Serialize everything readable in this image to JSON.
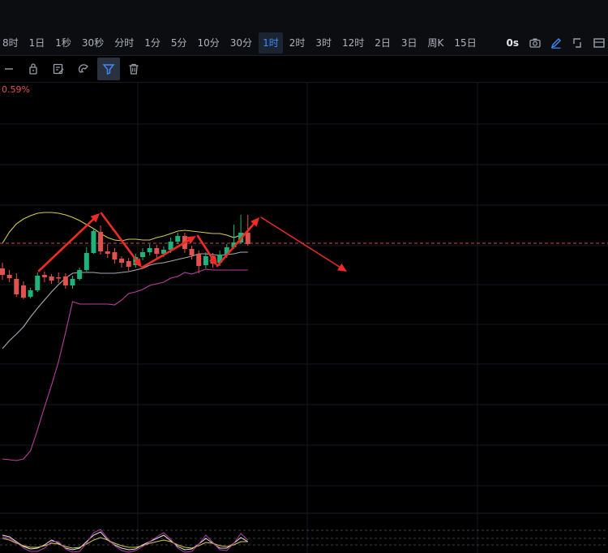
{
  "intervals": [
    {
      "label": "8时",
      "active": false
    },
    {
      "label": "1日",
      "active": false
    },
    {
      "label": "1秒",
      "active": false
    },
    {
      "label": "30秒",
      "active": false
    },
    {
      "label": "分时",
      "active": false
    },
    {
      "label": "1分",
      "active": false
    },
    {
      "label": "5分",
      "active": false
    },
    {
      "label": "10分",
      "active": false
    },
    {
      "label": "30分",
      "active": false
    },
    {
      "label": "1时",
      "active": true
    },
    {
      "label": "2时",
      "active": false
    },
    {
      "label": "3时",
      "active": false
    },
    {
      "label": "12时",
      "active": false
    },
    {
      "label": "2日",
      "active": false
    },
    {
      "label": "3日",
      "active": false
    },
    {
      "label": "周K",
      "active": false
    },
    {
      "label": "15日",
      "active": false
    }
  ],
  "right_tools": {
    "countdown_label": "0s",
    "icons": [
      "camera-icon",
      "pen-icon",
      "fullscreen-icon",
      "layout-icon"
    ]
  },
  "toolbar": {
    "icons": [
      "unknown-icon",
      "lock-icon",
      "edit-icon",
      "magnet-icon",
      "filter-icon",
      "trash-icon"
    ],
    "active_icon": "filter-icon"
  },
  "price_change": "0.59%",
  "colors": {
    "up": "#1db37a",
    "down": "#e0524f",
    "accent": "#3d8bff",
    "boll_upper": "#d6c94d",
    "boll_mid": "#a9aab0",
    "boll_lower": "#b6409f",
    "arrow": "#ef2b24",
    "price_line": "#c94a50"
  },
  "chart_data": {
    "type": "candlestick",
    "candles": [
      {
        "o": 331,
        "c": 339,
        "h": 324,
        "l": 345
      },
      {
        "o": 339,
        "c": 343,
        "h": 333,
        "l": 348
      },
      {
        "o": 344,
        "c": 363,
        "h": 337,
        "l": 366
      },
      {
        "o": 352,
        "c": 367,
        "h": 347,
        "l": 369
      },
      {
        "o": 366,
        "c": 358,
        "h": 355,
        "l": 368
      },
      {
        "o": 358,
        "c": 340,
        "h": 336,
        "l": 360
      },
      {
        "o": 339,
        "c": 342,
        "h": 335,
        "l": 348
      },
      {
        "o": 341,
        "c": 346,
        "h": 338,
        "l": 350
      },
      {
        "o": 342,
        "c": 343,
        "h": 336,
        "l": 349
      },
      {
        "o": 341,
        "c": 352,
        "h": 337,
        "l": 356
      },
      {
        "o": 352,
        "c": 344,
        "h": 340,
        "l": 356
      },
      {
        "o": 344,
        "c": 333,
        "h": 330,
        "l": 346
      },
      {
        "o": 333,
        "c": 312,
        "h": 305,
        "l": 335
      },
      {
        "o": 312,
        "c": 285,
        "h": 281,
        "l": 313
      },
      {
        "o": 286,
        "c": 310,
        "h": 278,
        "l": 314
      },
      {
        "o": 310,
        "c": 313,
        "h": 301,
        "l": 318
      },
      {
        "o": 311,
        "c": 320,
        "h": 306,
        "l": 325
      },
      {
        "o": 319,
        "c": 324,
        "h": 316,
        "l": 330
      },
      {
        "o": 322,
        "c": 329,
        "h": 318,
        "l": 334
      },
      {
        "o": 327,
        "c": 317,
        "h": 313,
        "l": 330
      },
      {
        "o": 317,
        "c": 311,
        "h": 306,
        "l": 321
      },
      {
        "o": 311,
        "c": 306,
        "h": 301,
        "l": 315
      },
      {
        "o": 306,
        "c": 313,
        "h": 302,
        "l": 318
      },
      {
        "o": 313,
        "c": 308,
        "h": 304,
        "l": 317
      },
      {
        "o": 308,
        "c": 298,
        "h": 293,
        "l": 312
      },
      {
        "o": 298,
        "c": 291,
        "h": 287,
        "l": 301
      },
      {
        "o": 291,
        "c": 307,
        "h": 287,
        "l": 312
      },
      {
        "o": 307,
        "c": 315,
        "h": 303,
        "l": 320
      },
      {
        "o": 313,
        "c": 328,
        "h": 309,
        "l": 337
      },
      {
        "o": 327,
        "c": 316,
        "h": 311,
        "l": 331
      },
      {
        "o": 316,
        "c": 325,
        "h": 312,
        "l": 330
      },
      {
        "o": 324,
        "c": 314,
        "h": 309,
        "l": 328
      },
      {
        "o": 314,
        "c": 305,
        "h": 301,
        "l": 318
      },
      {
        "o": 305,
        "c": 299,
        "h": 277,
        "l": 307
      },
      {
        "o": 299,
        "c": 287,
        "h": 265,
        "l": 301
      },
      {
        "o": 287,
        "c": 301,
        "h": 265,
        "l": 303
      }
    ],
    "boll_upper": [
      300,
      286,
      276,
      270,
      266,
      263,
      262,
      262,
      263,
      265,
      268,
      272,
      277,
      282,
      288,
      293,
      296,
      297,
      295,
      295,
      296,
      296,
      293,
      291,
      288,
      285,
      284,
      285,
      286,
      287,
      288,
      288,
      290,
      293,
      290,
      286
    ],
    "boll_mid": [
      430,
      420,
      412,
      403,
      391,
      380,
      370,
      360,
      351,
      343,
      337,
      336,
      336,
      336,
      337,
      337,
      337,
      336,
      335,
      333,
      331,
      327,
      325,
      324,
      322,
      320,
      318,
      316,
      313,
      313,
      314,
      315,
      314,
      313,
      311,
      311
    ],
    "boll_lower": [
      566,
      567,
      568,
      566,
      556,
      530,
      502,
      475,
      446,
      410,
      372,
      375,
      375,
      375,
      375,
      375,
      376,
      370,
      362,
      360,
      357,
      352,
      350,
      348,
      343,
      341,
      336,
      338,
      335,
      332,
      333,
      333,
      333,
      333,
      333,
      333
    ],
    "annotations": "red trend arrows drawn on chart"
  }
}
